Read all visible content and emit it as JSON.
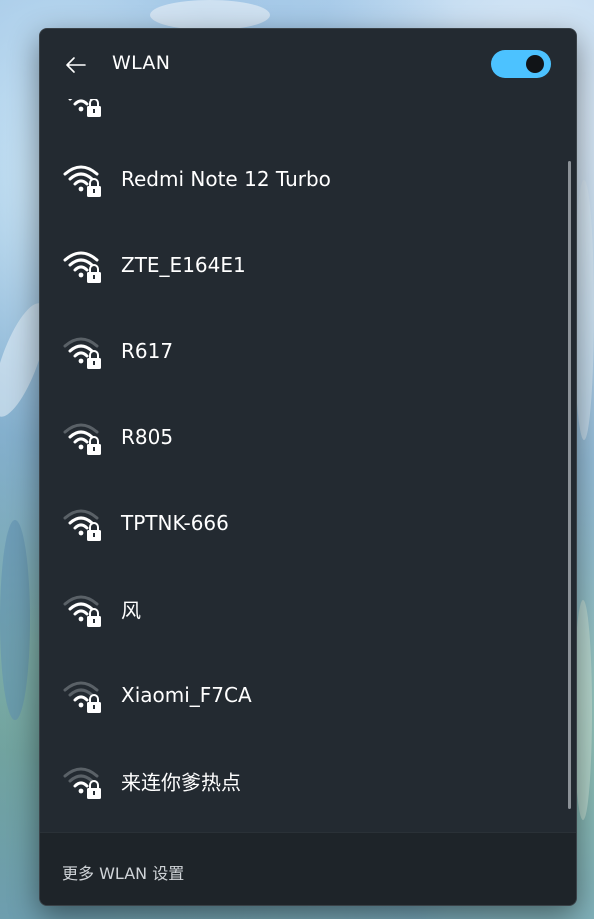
{
  "header": {
    "title": "WLAN",
    "back_icon": "arrow-left-icon",
    "toggle_state": "on",
    "accent_color": "#4cc2ff"
  },
  "networks": [
    {
      "ssid": "",
      "secured": true,
      "strength": "full",
      "partial": true
    },
    {
      "ssid": "Redmi Note 12 Turbo",
      "secured": true,
      "strength": "full"
    },
    {
      "ssid": "ZTE_E164E1",
      "secured": true,
      "strength": "full"
    },
    {
      "ssid": "R617",
      "secured": true,
      "strength": "medium"
    },
    {
      "ssid": "R805",
      "secured": true,
      "strength": "medium"
    },
    {
      "ssid": "TPTNK-666",
      "secured": true,
      "strength": "medium"
    },
    {
      "ssid": "风",
      "secured": true,
      "strength": "medium"
    },
    {
      "ssid": "Xiaomi_F7CA",
      "secured": true,
      "strength": "low"
    },
    {
      "ssid": "来连你爹热点",
      "secured": true,
      "strength": "low"
    }
  ],
  "footer": {
    "more_settings_label": "更多 WLAN 设置"
  }
}
